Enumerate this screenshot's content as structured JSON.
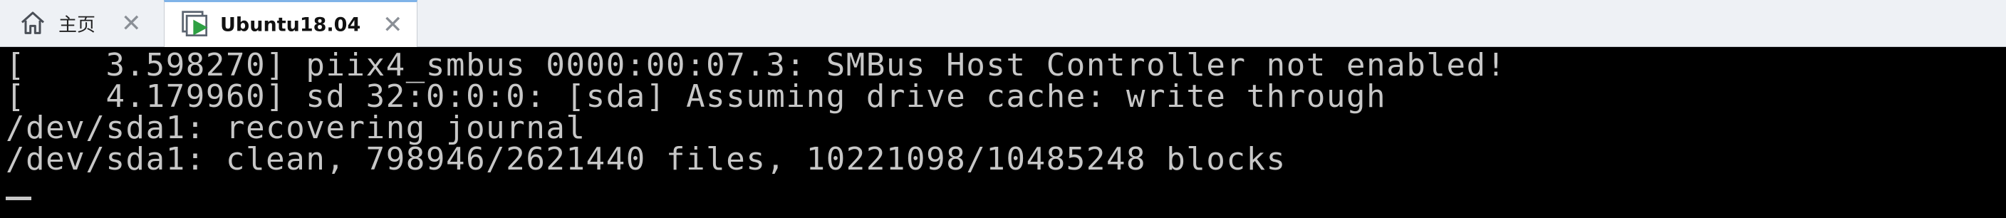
{
  "tabs": [
    {
      "label": "主页",
      "icon": "home-icon"
    },
    {
      "label": "Ubuntu18.04",
      "icon": "vm-running-icon",
      "active": true
    }
  ],
  "console": {
    "lines": [
      "[    3.598270] piix4_smbus 0000:00:07.3: SMBus Host Controller not enabled!",
      "[    4.179960] sd 32:0:0:0: [sda] Assuming drive cache: write through",
      "/dev/sda1: recovering journal",
      "/dev/sda1: clean, 798946/2621440 files, 10221098/10485248 blocks"
    ]
  },
  "colors": {
    "terminal_bg": "#000000",
    "terminal_fg": "#c7c7c7",
    "tabbar_bg": "#eef1f5",
    "play_green": "#2ea043"
  }
}
